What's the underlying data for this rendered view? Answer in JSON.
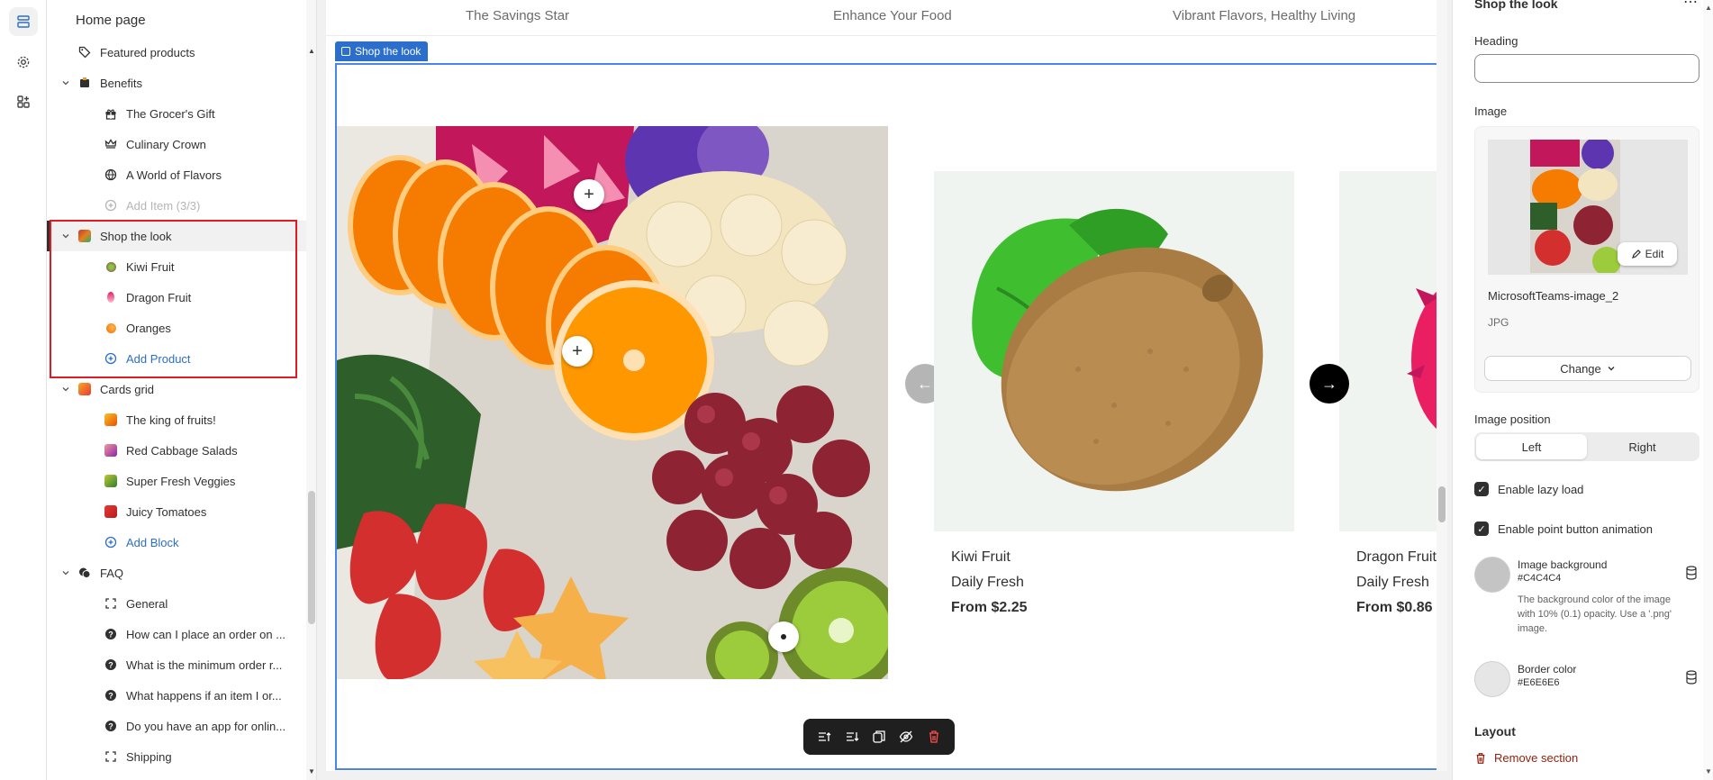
{
  "rail": {
    "icons": [
      "sections-icon",
      "settings-gear-icon",
      "apps-icon"
    ]
  },
  "tree": {
    "title": "Home page",
    "items": [
      {
        "label": "Featured products"
      },
      {
        "label": "Benefits"
      },
      {
        "label": "The Grocer's Gift"
      },
      {
        "label": "Culinary Crown"
      },
      {
        "label": "A World of Flavors"
      },
      {
        "label": "Add Item (3/3)"
      },
      {
        "label": "Shop the look"
      },
      {
        "label": "Kiwi Fruit"
      },
      {
        "label": "Dragon Fruit"
      },
      {
        "label": "Oranges"
      },
      {
        "label": "Add Product"
      },
      {
        "label": "Cards grid"
      },
      {
        "label": "The king of fruits!"
      },
      {
        "label": "Red Cabbage Salads"
      },
      {
        "label": "Super Fresh Veggies"
      },
      {
        "label": "Juicy Tomatoes"
      },
      {
        "label": "Add Block"
      },
      {
        "label": "FAQ"
      },
      {
        "label": "General"
      },
      {
        "label": "How can I place an order on ..."
      },
      {
        "label": "What is the minimum order r..."
      },
      {
        "label": "What happens if an item I or..."
      },
      {
        "label": "Do you have an app for onlin..."
      },
      {
        "label": "Shipping"
      }
    ]
  },
  "preview": {
    "strip": [
      "The Savings Star",
      "Enhance Your Food",
      "Vibrant Flavors, Healthy Living"
    ],
    "section_tag": "Shop the look",
    "hotspots": [
      "+",
      "+",
      ""
    ],
    "products": [
      {
        "name": "Kiwi Fruit",
        "subtitle": "Daily Fresh",
        "price": "From $2.25"
      },
      {
        "name": "Dragon Fruit",
        "subtitle": "Daily Fresh",
        "price": "From $0.86"
      }
    ],
    "nav": {
      "prev": "←",
      "next": "→"
    }
  },
  "settings": {
    "header": "Shop the look",
    "more": "⋯",
    "heading_label": "Heading",
    "heading_value": "",
    "image_label": "Image",
    "edit_label": "Edit",
    "file_name": "MicrosoftTeams-image_2",
    "file_type": "JPG",
    "change_label": "Change",
    "position_label": "Image position",
    "position_options": [
      "Left",
      "Right"
    ],
    "position_selected": "Left",
    "lazy_load_label": "Enable lazy load",
    "lazy_load": true,
    "point_anim_label": "Enable point button animation",
    "point_anim": true,
    "image_bg": {
      "name": "Image background",
      "hex": "#C4C4C4",
      "help": "The background color of the image with 10% (0.1) opacity. Use a '.png' image."
    },
    "border_color": {
      "name": "Border color",
      "hex": "#E6E6E6"
    },
    "layout_label": "Layout",
    "remove_label": "Remove section"
  },
  "colors": {
    "accent": "#2c6ecb",
    "highlight": "#e01b24",
    "danger": "#8e1f0b"
  }
}
